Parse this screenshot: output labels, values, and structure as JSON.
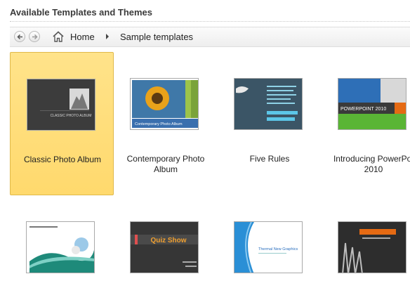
{
  "header": {
    "title": "Available Templates and Themes"
  },
  "nav": {
    "back_icon": "back-arrow-icon",
    "forward_icon": "forward-arrow-icon",
    "home_icon": "home-icon",
    "breadcrumb": [
      "Home",
      "Sample templates"
    ]
  },
  "templates": [
    {
      "label_line1": "Classic Photo Album",
      "label_line2": "",
      "selected": true,
      "thumb_text": "CLASSIC PHOTO ALBUM"
    },
    {
      "label_line1": "Contemporary Photo",
      "label_line2": "Album",
      "selected": false,
      "thumb_text": "Contemporary Photo Album"
    },
    {
      "label_line1": "Five Rules",
      "label_line2": "",
      "selected": false
    },
    {
      "label_line1": "Introducing PowerPoi",
      "label_line2": "2010",
      "selected": false,
      "thumb_text": "POWERPOINT 2010"
    },
    {
      "label_line1": "",
      "label_line2": "",
      "selected": false
    },
    {
      "label_line1": "",
      "label_line2": "",
      "selected": false,
      "thumb_text": "Quiz Show"
    },
    {
      "label_line1": "",
      "label_line2": "",
      "selected": false,
      "thumb_text": "Thermal New Graphics"
    },
    {
      "label_line1": "",
      "label_line2": "",
      "selected": false
    }
  ],
  "colors": {
    "selected_bg": "#ffd96d",
    "accent_orange": "#e56a13",
    "blue": "#2a6fbf"
  }
}
